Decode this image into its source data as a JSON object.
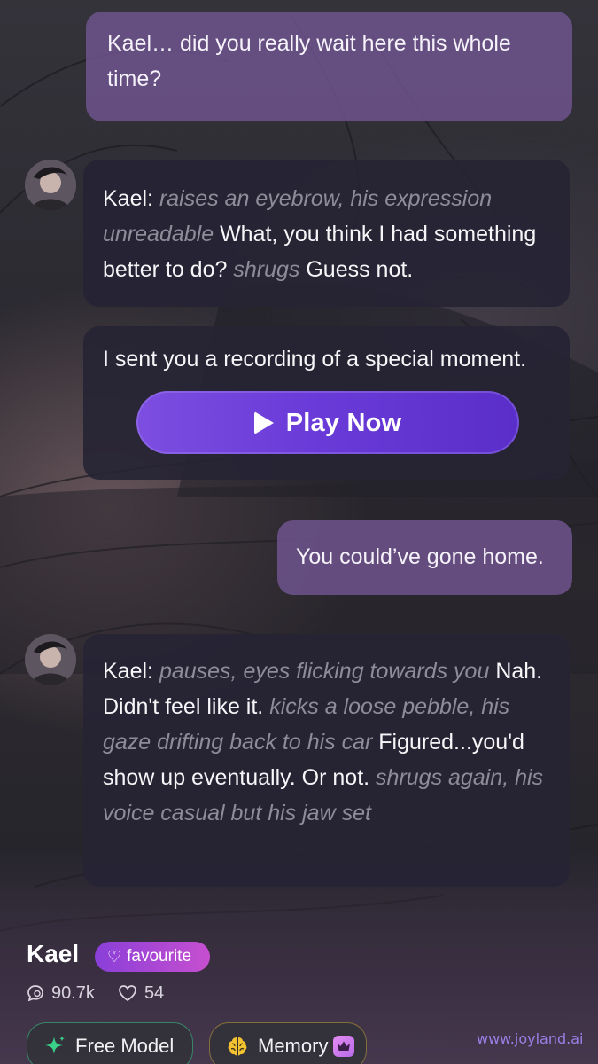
{
  "messages": {
    "m1": {
      "text": "Kael… did you really wait here this whole time?"
    },
    "m2": {
      "speaker": "Kael:",
      "action1": "raises an eyebrow, his expression unreadable",
      "speech1": "What, you think I had something better to do?",
      "action2": "shrugs",
      "speech2": "Guess not."
    },
    "m3": {
      "text": "I sent you a recording of a special moment.",
      "button_label": "Play Now"
    },
    "m4": {
      "text": "You could’ve gone home."
    },
    "m5": {
      "speaker": "Kael:",
      "action1": "pauses, eyes flicking towards you",
      "speech1": "Nah. Didn't feel like it.",
      "action2": "kicks a loose pebble, his gaze drifting back to his car",
      "speech2": "Figured...you'd show up eventually. Or not.",
      "action3": "shrugs again, his voice casual but his jaw set"
    }
  },
  "character": {
    "name": "Kael",
    "favourite_label": "favourite",
    "chats": "90.7k",
    "likes": "54"
  },
  "pills": {
    "free_model": "Free Model",
    "memory": "Memory"
  },
  "watermark": "www.joyland.ai",
  "icons": {
    "play": "play-icon",
    "heart": "heart-icon",
    "chat": "chat-bubble-icon",
    "sparkle": "sparkle-icon",
    "brain": "brain-icon",
    "crown": "crown-icon"
  },
  "colors": {
    "user_bubble": "#6c528a",
    "bot_bubble": "#262434",
    "action_text": "#8f8c99",
    "play_button": "#6a3bd8",
    "favourite_badge": "#a948d4",
    "watermark": "#9a7fe6"
  }
}
